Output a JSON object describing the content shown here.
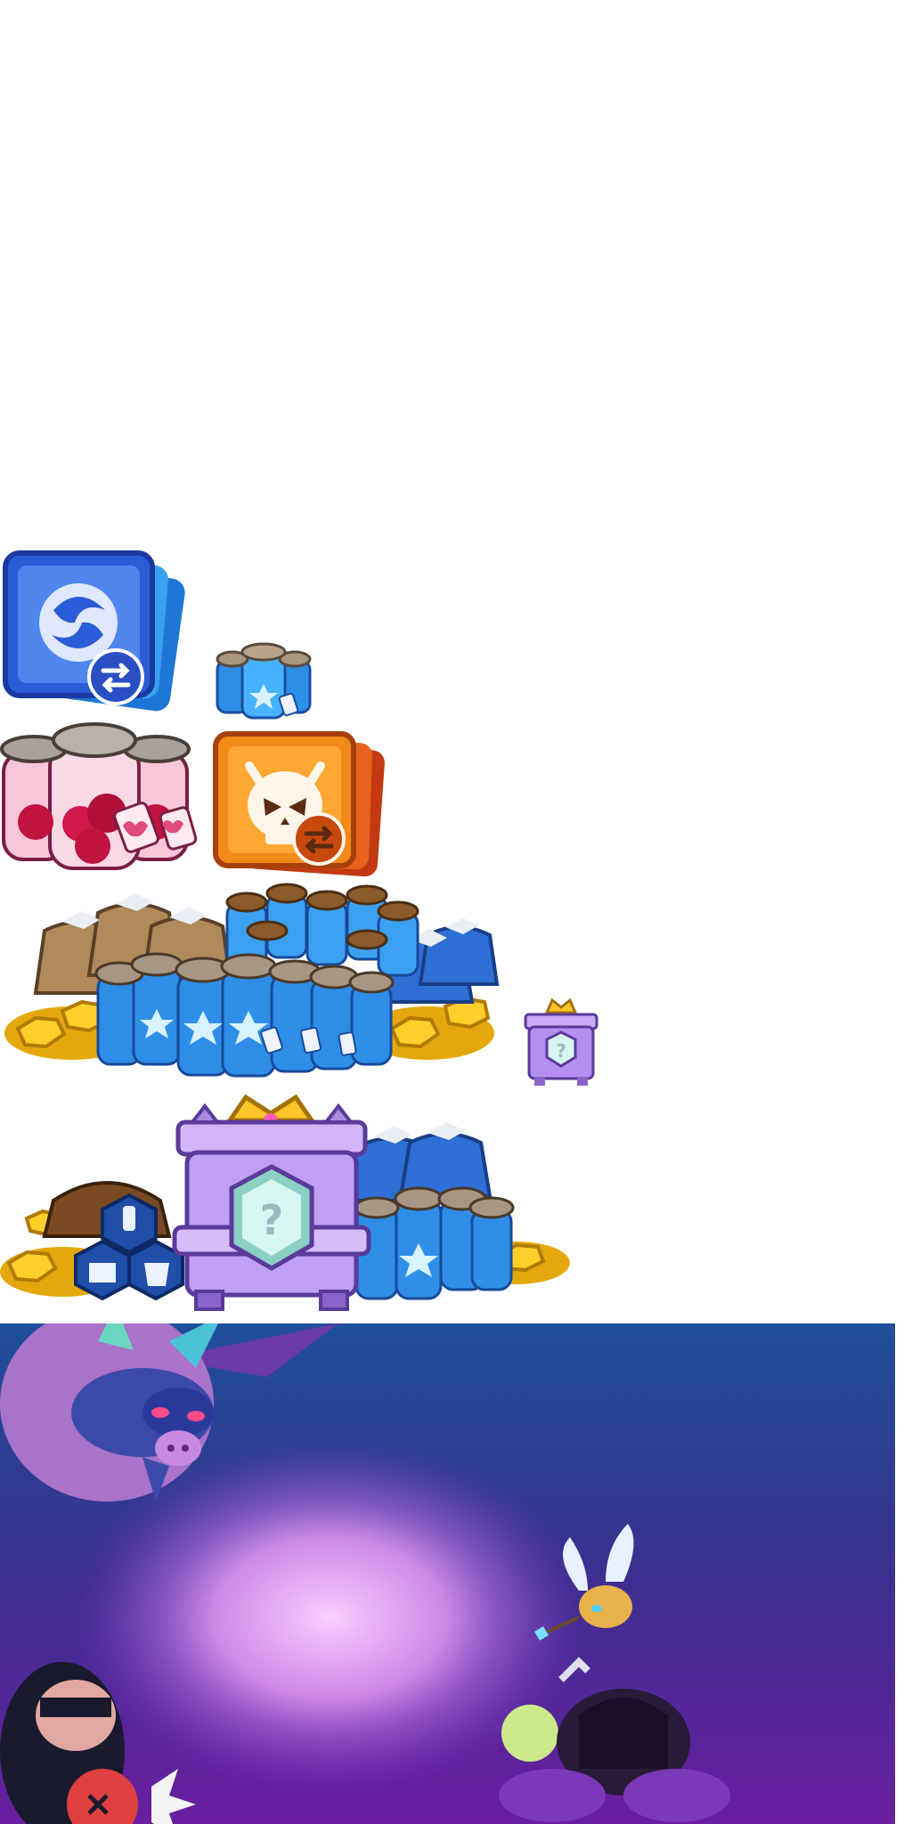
{
  "atlas": {
    "title": "",
    "items": [
      {
        "name": "blue-swap-card-icon"
      },
      {
        "name": "small-mana-jars-icon"
      },
      {
        "name": "heart-potion-jars-icon"
      },
      {
        "name": "orange-skull-swap-card-icon"
      },
      {
        "name": "treasure-hoard-icon"
      },
      {
        "name": "small-mystery-chest-icon"
      },
      {
        "name": "royal-mystery-chest-hoard-icon"
      }
    ],
    "chest_symbol": "?"
  },
  "scene": {
    "name": "battle-background-scene",
    "colors": {
      "top": "#1f4f9a",
      "mid": "#3b2f8f",
      "bottom": "#6a1ea0",
      "glow": "#f6b6ff"
    }
  }
}
